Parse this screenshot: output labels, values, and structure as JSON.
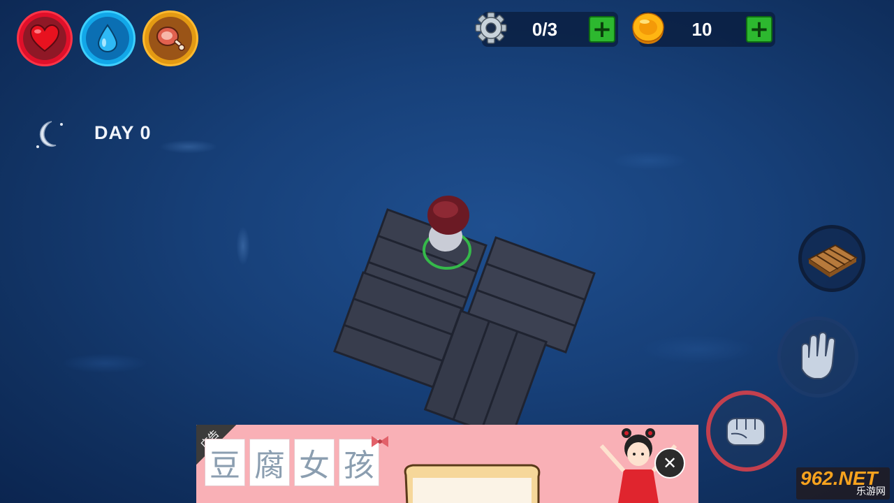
{
  "hud": {
    "stats": {
      "health_icon": "heart-icon",
      "water_icon": "water-drop-icon",
      "food_icon": "meat-icon"
    },
    "scrap": {
      "icon": "gear-icon",
      "value": "0/3",
      "add_label": "+"
    },
    "coins": {
      "icon": "coin-icon",
      "value": "10",
      "add_label": "+"
    },
    "day": {
      "icon": "moon-icon",
      "label": "DAY 0"
    }
  },
  "actions": {
    "build_icon": "wood-plank-icon",
    "grab_icon": "open-hand-icon",
    "attack_icon": "fist-icon"
  },
  "ad": {
    "tag": "广告",
    "title_chars": [
      "豆",
      "腐",
      "女",
      "孩"
    ],
    "close_label": "✕"
  },
  "watermark": {
    "big": "962.NET",
    "small": "乐游网"
  },
  "colors": {
    "health": "#e0102a",
    "water": "#12a7e8",
    "food": "#e39a13",
    "plus": "#2db82f",
    "attack_ring": "#c3404e"
  }
}
